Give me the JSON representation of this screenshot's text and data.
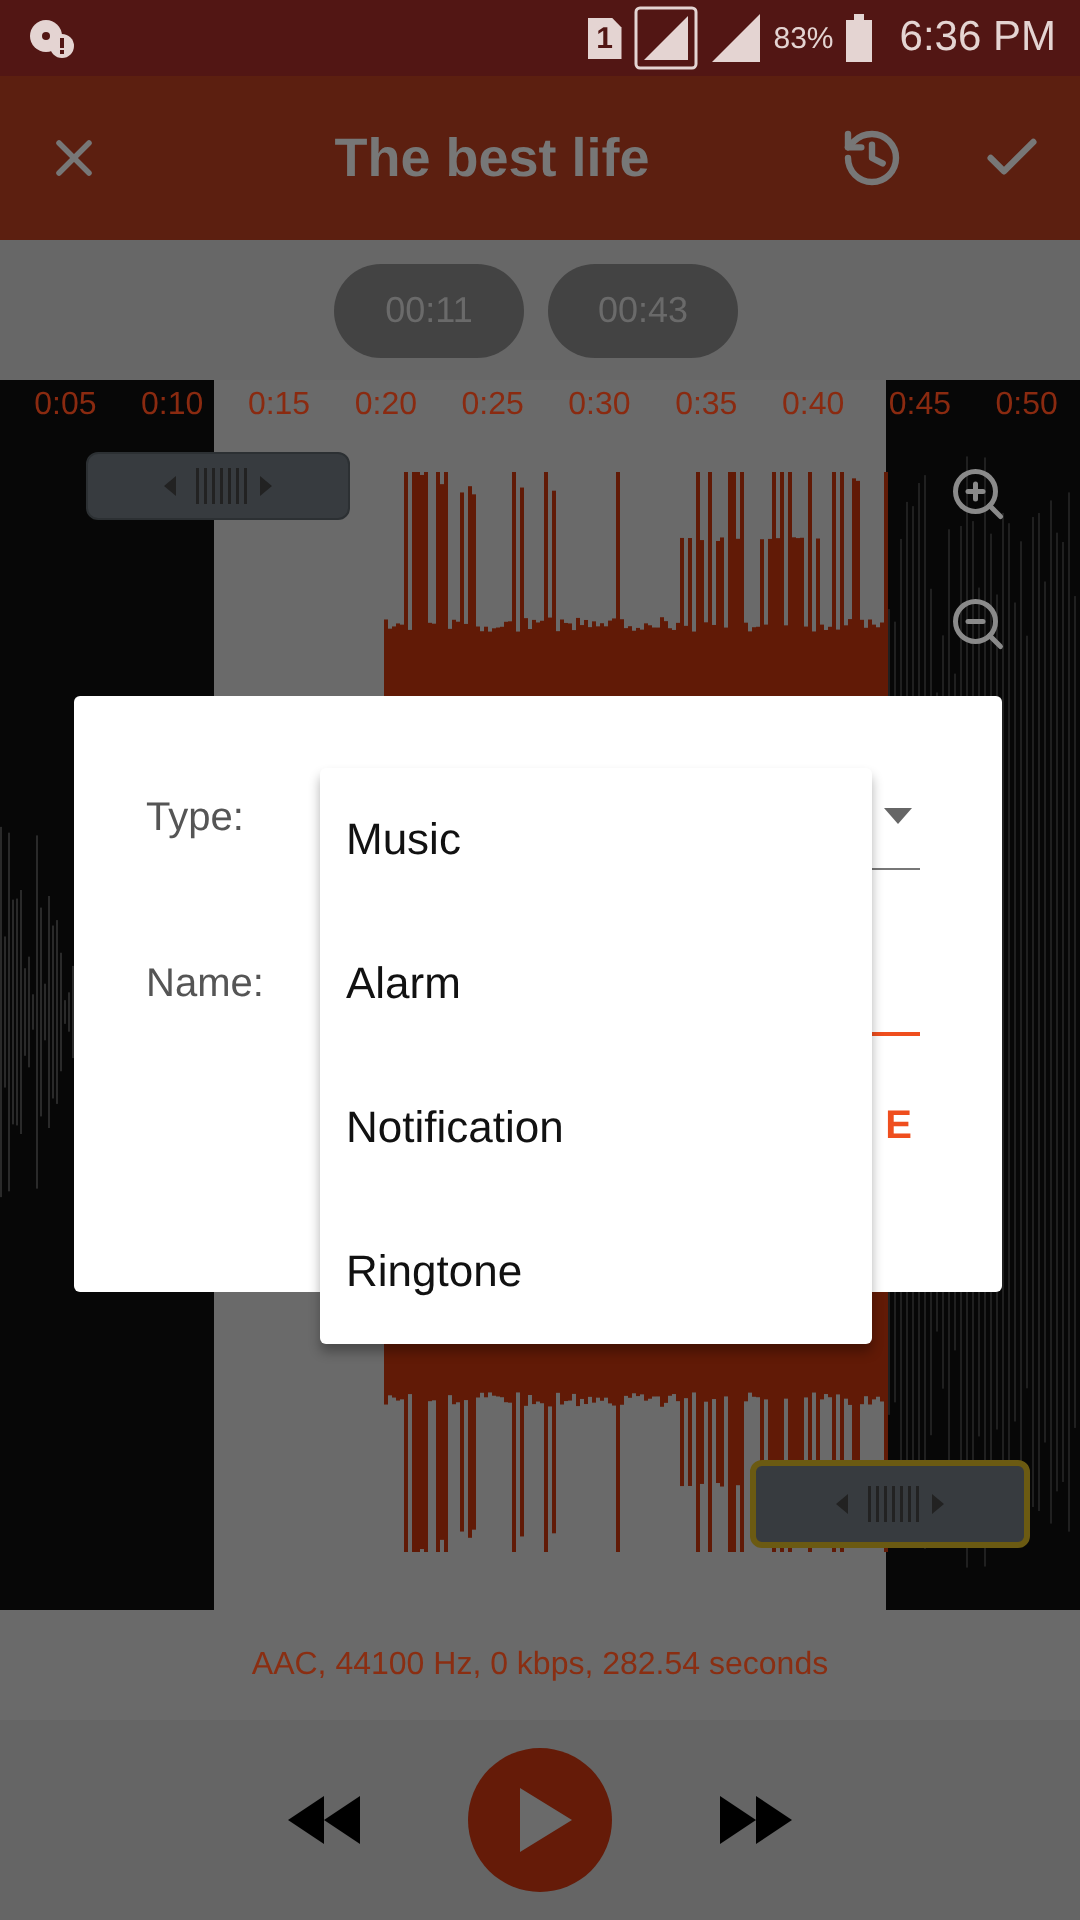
{
  "status_bar": {
    "sim_slot": "1",
    "battery": "83%",
    "time": "6:36 PM"
  },
  "toolbar": {
    "title": "The best life"
  },
  "markers": {
    "start": "00:11",
    "end": "00:43"
  },
  "timeline": {
    "labels": [
      "0:05",
      "0:10",
      "0:15",
      "0:20",
      "0:25",
      "0:30",
      "0:35",
      "0:40",
      "0:45",
      "0:50"
    ]
  },
  "info": "AAC, 44100 Hz, 0 kbps, 282.54 seconds",
  "dialog": {
    "type_label": "Type:",
    "name_label": "Name:",
    "button_fragment": "E"
  },
  "dropdown": {
    "options": [
      "Music",
      "Alarm",
      "Notification",
      "Ringtone"
    ]
  }
}
